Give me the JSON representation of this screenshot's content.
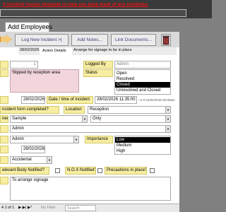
{
  "banner": {
    "title": "ll incident tracker template to help you keep track of any incidents."
  },
  "tab": {
    "label": "Add Employees"
  },
  "toolbar": {
    "log_new": "Log New Incident >|",
    "add_notes": "Add Notes...",
    "link_documents": "Link Documents..."
  },
  "header_row": {
    "date": "28/02/2026",
    "action_details_label": "Action Details",
    "action_details_value": "Arrange for signage to be in place"
  },
  "row1": {
    "id": "1",
    "logged_by_label": "Logged By",
    "logged_by_value": "Admin"
  },
  "description": {
    "value": "Slipped by reception area"
  },
  "status": {
    "label": "Status",
    "options": [
      "Open",
      "Resolved",
      "Closed",
      "Unresolved and Closed"
    ],
    "selected_index": 2
  },
  "incident_date_row": {
    "date": "28/02/2026",
    "time_label": "Date / time of incident",
    "datetime_value": "28/02/2026 11:35:00",
    "extra": "\" £ 0  01/01/2015 00:00am"
  },
  "form_completed_row": {
    "label": "ncident form completed?",
    "location_label": "Location",
    "location_value": "Reception"
  },
  "row_sample": {
    "label": "ned",
    "value": "Sample",
    "qualifier": "Only"
  },
  "row_admin": {
    "value": "Admin"
  },
  "row_admin2": {
    "value": "Admin",
    "importance_label": "Importance",
    "importance_options": [
      "Low",
      "Medium",
      "High"
    ],
    "importance_selected_index": 0
  },
  "row_date2": {
    "value": "28/02/2026"
  },
  "row_accidental": {
    "value": "Accidental"
  },
  "notified_row": {
    "relevant_label": "elevant Body Notified?",
    "nox_label": "N.O.X Notified?",
    "precautions_label": "Precautions in place?"
  },
  "notes": {
    "value": "To arrange signage"
  },
  "status_bar": {
    "record_label": "4 1 of 1",
    "nav": "▶  ▶|  ▶*",
    "no_filter": "No Filter",
    "search": "Search"
  }
}
